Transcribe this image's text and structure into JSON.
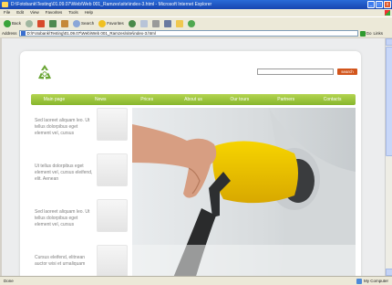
{
  "window": {
    "title": "D:\\Fotobank\\Testing\\01.09.07\\Web\\Web 001_Ramzes\\site\\index-3.html - Microsoft Internet Explorer",
    "minimize": "_",
    "maximize": "□",
    "close": "x"
  },
  "menu": [
    "File",
    "Edit",
    "View",
    "Favorites",
    "Tools",
    "Help"
  ],
  "toolbar": {
    "back": "Back",
    "search": "Search",
    "favorites": "Favorites"
  },
  "address": {
    "label": "Address",
    "url": "D:\\Fotobank\\Testing\\01.09.07\\Web\\Web 001_Ramzes\\site\\index-3.html",
    "go": "Go",
    "links": "Links"
  },
  "site": {
    "search_button": "search",
    "nav": [
      "Main page",
      "News",
      "Prices",
      "About us",
      "Our tours",
      "Partners",
      "Contacts"
    ],
    "news": [
      "Sed laoreet aliquam leo. Ut tellus dolorpibus eget element vel, cursus",
      "Ut tellus dolorpibus eget element vel, cursus eleifend, elit. Aenean",
      "Sed laoreet aliquam leo. Ut tellus dolorpibus eget element vel, cursus",
      "Cursus eleifend, elitnean auctor wisi et urnaliquam"
    ]
  },
  "status": {
    "text": "Done",
    "zone": "My Computer"
  },
  "colors": {
    "nav_green": "#9cc43c",
    "search_orange": "#d2551c",
    "logo_green": "#69a533"
  }
}
